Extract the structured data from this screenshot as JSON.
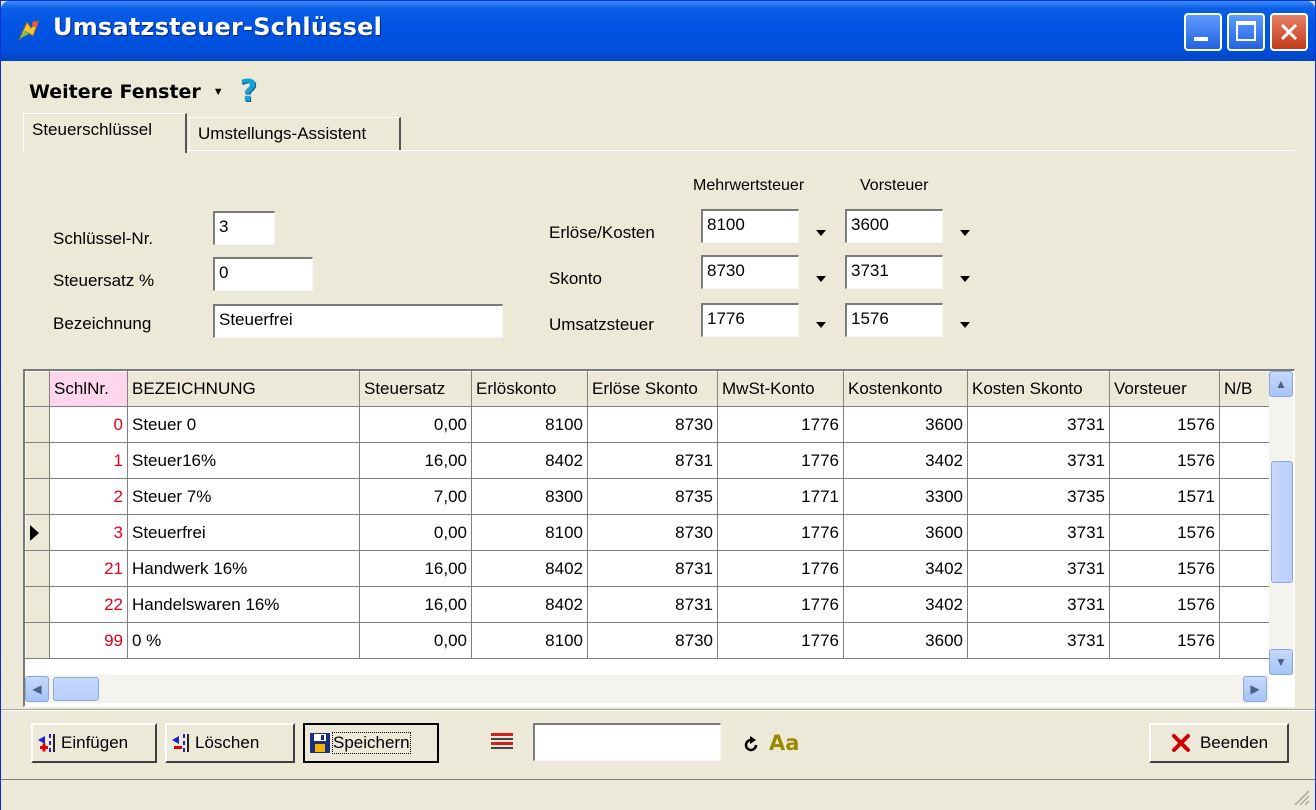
{
  "window": {
    "title": "Umsatzsteuer-Schlüssel"
  },
  "menu": {
    "label": "Weitere Fenster",
    "help": "?"
  },
  "tabs": [
    {
      "label": "Steuerschlüssel",
      "active": true
    },
    {
      "label": "Umstellungs-Assistent",
      "active": false
    }
  ],
  "form": {
    "schluessel_label": "Schlüssel-Nr.",
    "schluessel_value": "3",
    "steuersatz_label": "Steuersatz %",
    "steuersatz_value": "0",
    "bezeichnung_label": "Bezeichnung",
    "bezeichnung_value": "Steuerfrei",
    "col_mehrwertsteuer": "Mehrwertsteuer",
    "col_vorsteuer": "Vorsteuer",
    "erloese_label": "Erlöse/Kosten",
    "erloese_mwst": "8100",
    "erloese_vst": "3600",
    "skonto_label": "Skonto",
    "skonto_mwst": "8730",
    "skonto_vst": "3731",
    "ust_label": "Umsatzsteuer",
    "ust_mwst": "1776",
    "ust_vst": "1576"
  },
  "grid": {
    "columns": [
      "SchlNr.",
      "BEZEICHNUNG",
      "Steuersatz",
      "Erlöskonto",
      "Erlöse Skonto",
      "MwSt-Konto",
      "Kostenkonto",
      "Kosten Skonto",
      "Vorsteuer",
      "N/B"
    ],
    "rows": [
      [
        "0",
        "Steuer 0",
        "0,00",
        "8100",
        "8730",
        "1776",
        "3600",
        "3731",
        "1576"
      ],
      [
        "1",
        "Steuer16%",
        "16,00",
        "8402",
        "8731",
        "1776",
        "3402",
        "3731",
        "1576"
      ],
      [
        "2",
        "Steuer 7%",
        "7,00",
        "8300",
        "8735",
        "1771",
        "3300",
        "3735",
        "1571"
      ],
      [
        "3",
        "Steuerfrei",
        "0,00",
        "8100",
        "8730",
        "1776",
        "3600",
        "3731",
        "1576"
      ],
      [
        "21",
        "Handwerk 16%",
        "16,00",
        "8402",
        "8731",
        "1776",
        "3402",
        "3731",
        "1576"
      ],
      [
        "22",
        "Handelswaren 16%",
        "16,00",
        "8402",
        "8731",
        "1776",
        "3402",
        "3731",
        "1576"
      ],
      [
        "99",
        "0 %",
        "0,00",
        "8100",
        "8730",
        "1776",
        "3600",
        "3731",
        "1576"
      ]
    ],
    "current_row": 3
  },
  "toolbar": {
    "insert": "Einfügen",
    "delete": "Löschen",
    "save": "Speichern",
    "search_value": "",
    "font_label": "Aa",
    "close": "Beenden"
  },
  "colors": {
    "titlebar": "#0054E3",
    "key_text": "#E0001A",
    "face": "#ECE9D8"
  }
}
